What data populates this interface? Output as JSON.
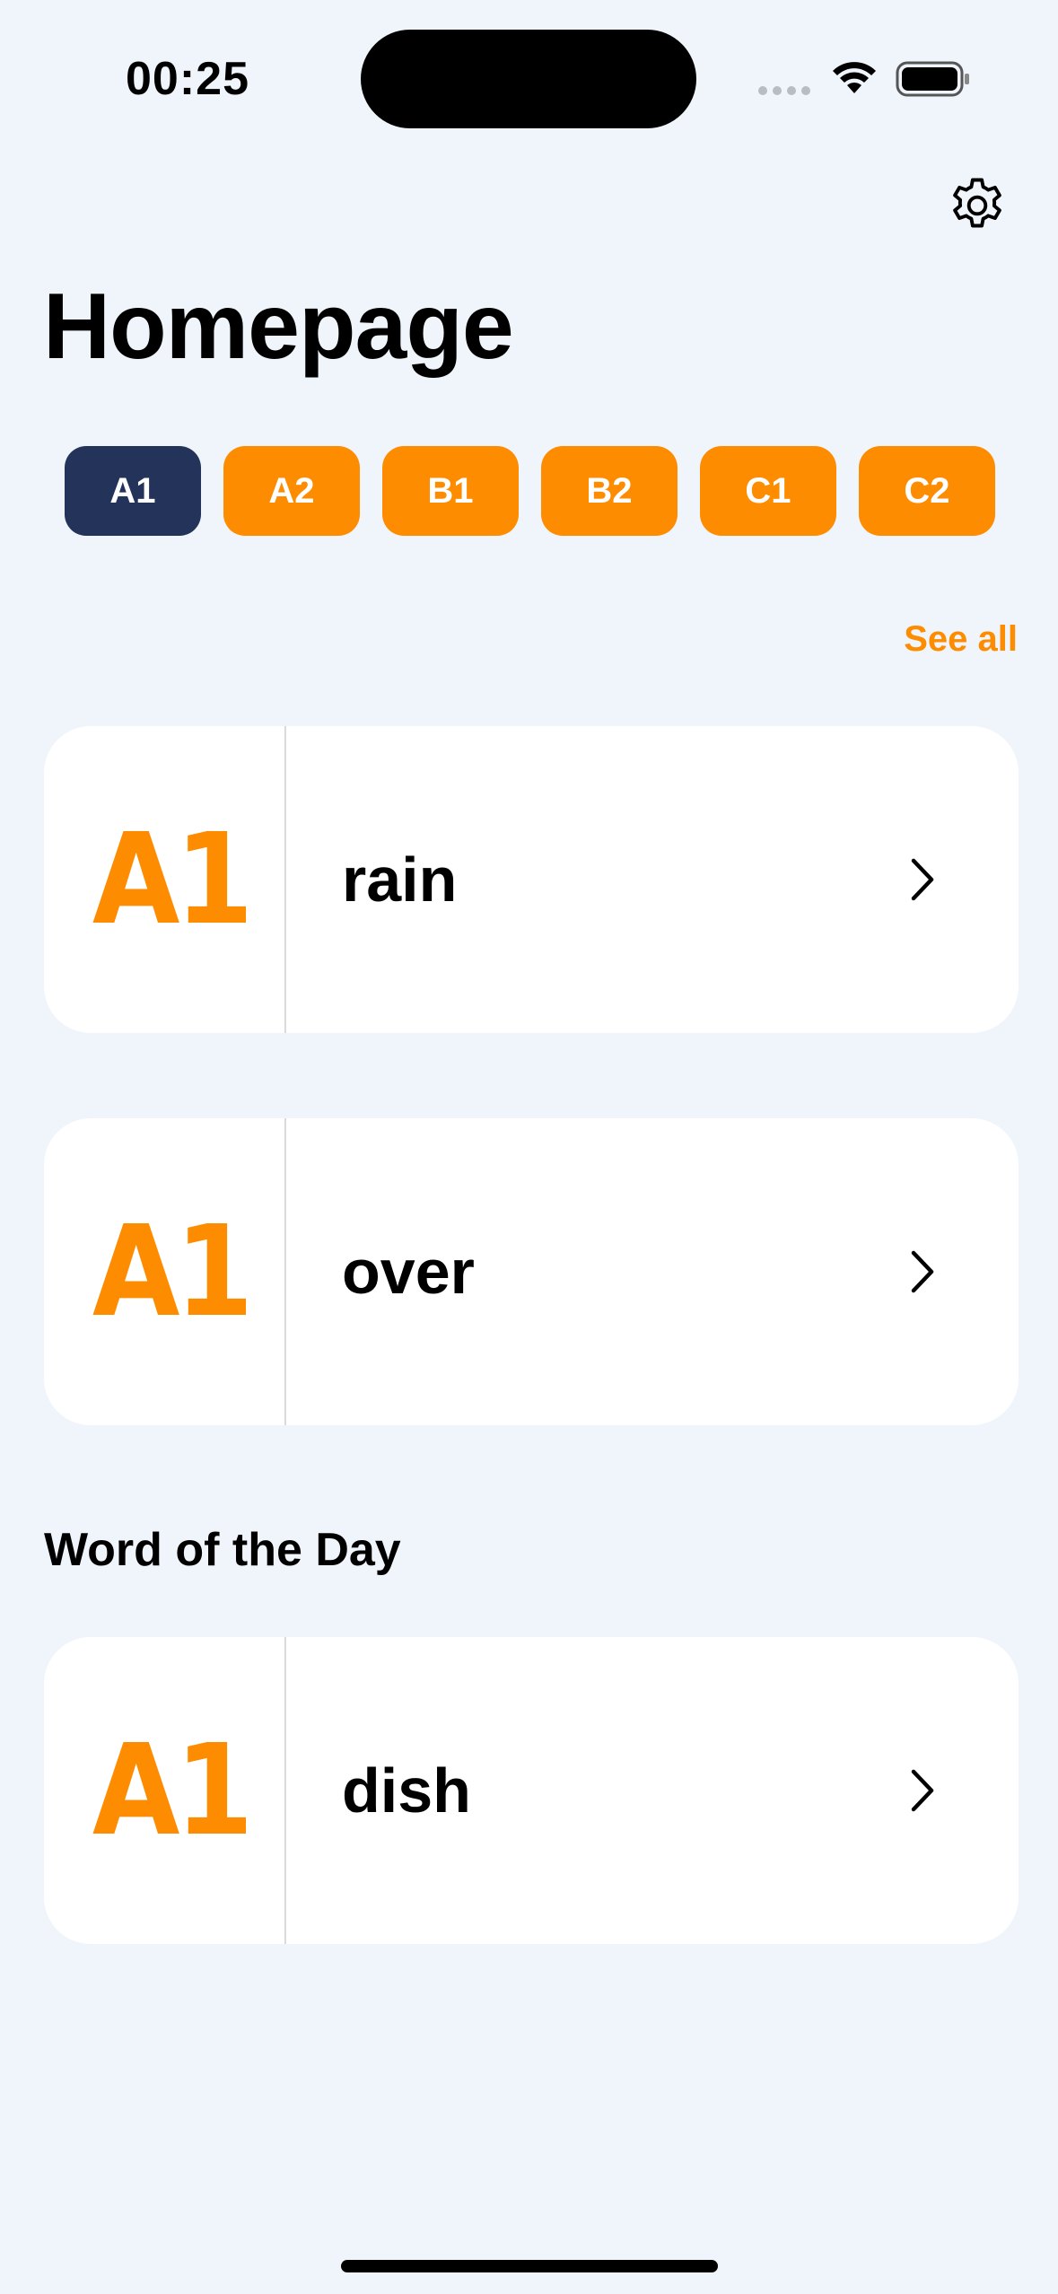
{
  "status_bar": {
    "time": "00:25"
  },
  "header": {
    "title": "Homepage"
  },
  "levels": [
    {
      "label": "A1",
      "active": true
    },
    {
      "label": "A2",
      "active": false
    },
    {
      "label": "B1",
      "active": false
    },
    {
      "label": "B2",
      "active": false
    },
    {
      "label": "C1",
      "active": false
    },
    {
      "label": "C2",
      "active": false
    }
  ],
  "see_all_label": "See all",
  "words": [
    {
      "level": "A1",
      "word": "rain"
    },
    {
      "level": "A1",
      "word": "over"
    }
  ],
  "word_of_day": {
    "section_title": "Word of the Day",
    "level": "A1",
    "word": "dish"
  },
  "colors": {
    "accent": "#fe8c00",
    "active_chip": "#24335a",
    "background": "#f0f5fc"
  },
  "icons": [
    "wifi-icon",
    "battery-icon",
    "gear-icon",
    "chevron-right-icon"
  ]
}
